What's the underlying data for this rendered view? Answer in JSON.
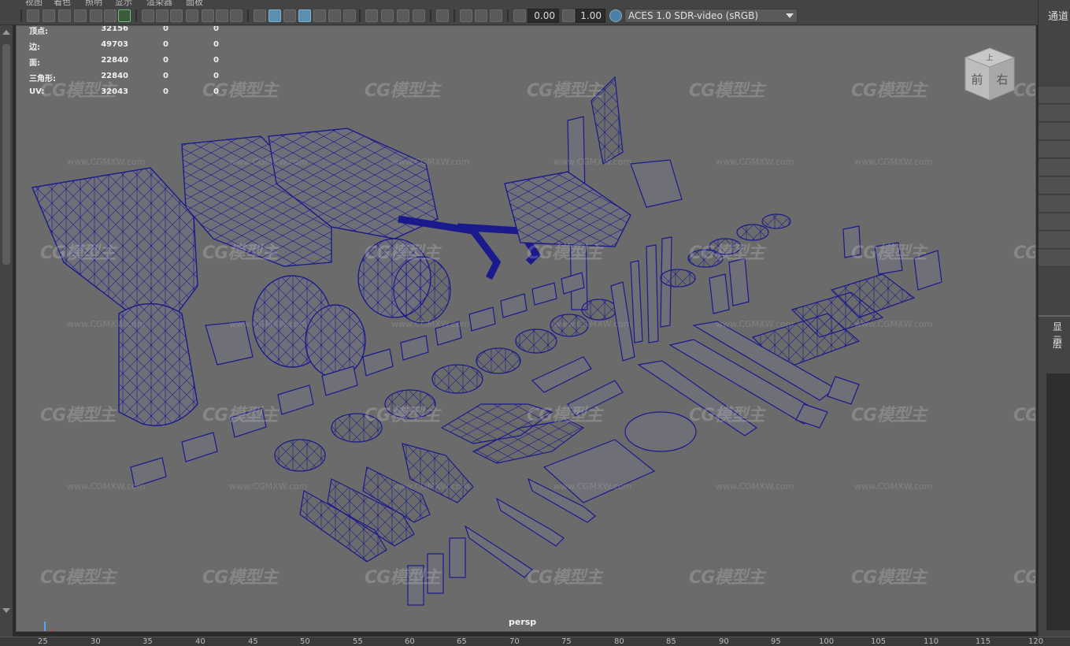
{
  "menu": [
    "视图",
    "着色",
    "照明",
    "显示",
    "渲染器",
    "面板"
  ],
  "toolbar": {
    "exposure": "0.00",
    "gamma": "1.00",
    "color_management": "ACES 1.0 SDR-video (sRGB)"
  },
  "hud": [
    {
      "label": "顶点:",
      "v1": "32156",
      "v2": "0",
      "v3": "0"
    },
    {
      "label": "边:",
      "v1": "49703",
      "v2": "0",
      "v3": "0"
    },
    {
      "label": "面:",
      "v1": "22840",
      "v2": "0",
      "v3": "0"
    },
    {
      "label": "三角形:",
      "v1": "22840",
      "v2": "0",
      "v3": "0"
    },
    {
      "label": "UV:",
      "v1": "32043",
      "v2": "0",
      "v3": "0"
    }
  ],
  "camera_label": "persp",
  "viewcube": {
    "top": "上",
    "front": "前",
    "right": "右"
  },
  "watermark_text": "CG模型主",
  "watermark_url": "www.CGMXW.com",
  "right_panel": {
    "channels_tab": "通道",
    "display_tab": "显示",
    "layers_tab": "层"
  },
  "ruler_ticks": [
    "25",
    "30",
    "35",
    "40",
    "45",
    "50",
    "55",
    "60",
    "65",
    "70",
    "75",
    "80",
    "85",
    "90",
    "95",
    "100",
    "105",
    "110",
    "115",
    "120"
  ],
  "colors": {
    "viewport_bg": "#6b6b6b",
    "wire": "#1a1a8c",
    "mesh": "#6f6f78",
    "panel_bg": "#444444"
  }
}
